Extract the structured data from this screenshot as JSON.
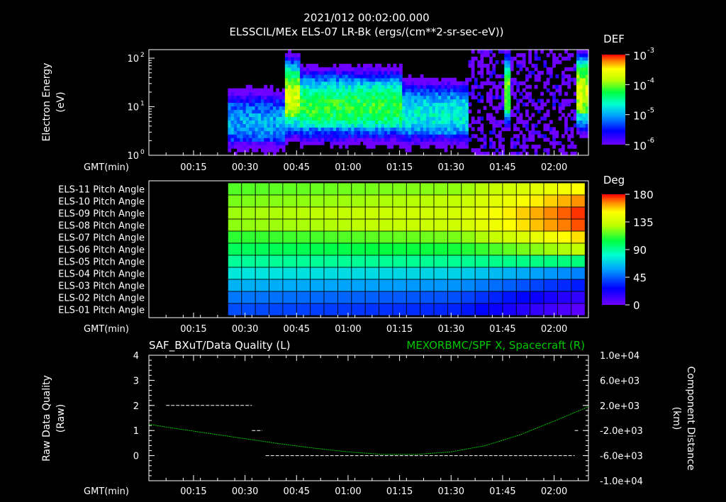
{
  "header": {
    "title_line1": "2021/012 00:02:00.000",
    "title_line2": "ELSSCIL/MEx ELS-07 LR-Bk  (ergs/(cm**2-sr-sec-eV))"
  },
  "time_axis": {
    "label": "GMT(min)",
    "ticks": [
      "00:15",
      "00:30",
      "00:45",
      "01:00",
      "01:15",
      "01:30",
      "01:45",
      "02:00"
    ]
  },
  "chart_data": [
    {
      "type": "heatmap",
      "title": "ELSSCIL/MEx ELS-07 LR-Bk  (ergs/(cm**2-sr-sec-eV))",
      "ylabel_line1": "Electron Energy",
      "ylabel_line2": "(eV)",
      "yscale": "log",
      "ylim": [
        1,
        150
      ],
      "y_tick_bases": [
        "10",
        "10",
        "10"
      ],
      "y_tick_exps": [
        "0",
        "1",
        "2"
      ],
      "xlim_minutes": [
        2,
        130
      ],
      "data_start_minute": 25,
      "colorbar": {
        "label": "DEF",
        "tick_bases": [
          "10",
          "10",
          "10",
          "10"
        ],
        "tick_exps": [
          "-3",
          "-4",
          "-5",
          "-6"
        ],
        "range": [
          1e-06,
          0.001
        ]
      },
      "features": [
        {
          "t_start": 25,
          "t_end": 41,
          "peak_energy_ev": 5,
          "level": 1e-05
        },
        {
          "t_start": 41,
          "t_end": 46,
          "peak_energy_ev": 15,
          "level": 0.0002
        },
        {
          "t_start": 46,
          "t_end": 75,
          "peak_energy_ev": 10,
          "level": 6e-05
        },
        {
          "t_start": 75,
          "t_end": 95,
          "peak_energy_ev": 7,
          "level": 2e-05
        },
        {
          "t_start": 105,
          "t_end": 107,
          "peak_energy_ev": 20,
          "level": 0.0001
        },
        {
          "t_start": 126,
          "t_end": 130,
          "peak_energy_ev": 20,
          "level": 0.0002
        }
      ]
    },
    {
      "type": "heatmap",
      "rows": [
        "ELS-11 Pitch Angle",
        "ELS-10 Pitch Angle",
        "ELS-09 Pitch Angle",
        "ELS-08 Pitch Angle",
        "ELS-07 Pitch Angle",
        "ELS-06 Pitch Angle",
        "ELS-05 Pitch Angle",
        "ELS-04 Pitch Angle",
        "ELS-03 Pitch Angle",
        "ELS-02 Pitch Angle",
        "ELS-01 Pitch Angle"
      ],
      "xlim_minutes": [
        2,
        130
      ],
      "data_start_minute": 25,
      "data_end_minute": 128,
      "time_step_minutes": 4,
      "start_deg": [
        115,
        120,
        125,
        123,
        110,
        100,
        90,
        75,
        62,
        50,
        42
      ],
      "end_deg": [
        150,
        165,
        175,
        172,
        155,
        130,
        95,
        52,
        32,
        15,
        5
      ],
      "colorbar": {
        "label": "Deg",
        "ticks": [
          "180",
          "135",
          "90",
          "45",
          "0"
        ],
        "range": [
          0,
          180
        ]
      }
    },
    {
      "type": "line",
      "title_left": "SAF_BXuT/Data Quality (L)",
      "title_right": "MEXORBMC/SPF X, Spacecraft (R)",
      "ylabel_left_line1": "Raw Data Quality",
      "ylabel_left_line2": "(Raw)",
      "ylabel_right_line1": "Component Distance",
      "ylabel_right_line2": "(km)",
      "ylim_left": [
        -1,
        4
      ],
      "y_ticks_left": [
        "4",
        "3",
        "2",
        "1",
        "0"
      ],
      "ylim_right": [
        -10000,
        10000
      ],
      "y_ticks_right": [
        "1.0e+04",
        "6.0e+03",
        "2.0e+03",
        "-2.0e+03",
        "-6.0e+03",
        "-1.0e+04"
      ],
      "xlim_minutes": [
        2,
        130
      ],
      "series": [
        {
          "name": "SAF_BXuT/Data Quality",
          "color": "#ffffff",
          "segments": [
            {
              "x": [
                7,
                32
              ],
              "y": 2
            },
            {
              "x": [
                32,
                35
              ],
              "y": 1
            },
            {
              "x": [
                36,
                126
              ],
              "y": 0
            },
            {
              "x": [
                126,
                127
              ],
              "y": 1
            }
          ]
        },
        {
          "name": "MEXORBMC/SPF X, Spacecraft",
          "color": "#00c800",
          "x": [
            2,
            10,
            20,
            30,
            40,
            50,
            60,
            70,
            80,
            90,
            100,
            110,
            120,
            130
          ],
          "y": [
            -1000,
            -1700,
            -2500,
            -3300,
            -4100,
            -4800,
            -5400,
            -5800,
            -5800,
            -5400,
            -4400,
            -2700,
            -500,
            1800
          ]
        }
      ]
    }
  ]
}
